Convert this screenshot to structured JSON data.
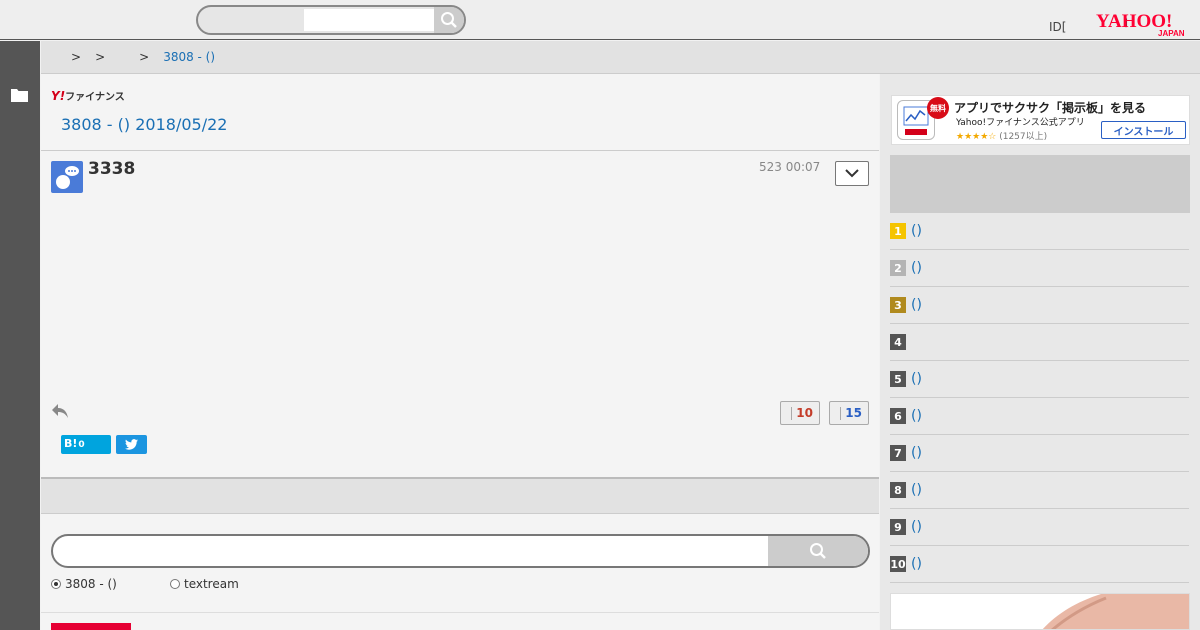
{
  "header": {
    "search_placeholder": "",
    "id_label": "ID[",
    "id_caret": "]",
    "logo_text": "YAHOO!",
    "logo_sub": "JAPAN"
  },
  "breadcrumb": {
    "sep": ">",
    "current": "3808 - ()"
  },
  "main": {
    "finance_logo_y": "Y!",
    "finance_logo_text": "ファイナンス",
    "board_title": "3808 - () 2018/05/22",
    "post": {
      "author": "3338",
      "timestamp": "523 00:07",
      "likes": "10",
      "dislikes": "15",
      "hatena_label": "B!",
      "hatena_count": "0"
    },
    "search": {
      "placeholder": "",
      "options": [
        {
          "label": "3808 - ()",
          "checked": true
        },
        {
          "label": "textream",
          "checked": false
        }
      ]
    }
  },
  "sidebar": {
    "app_ad": {
      "badge": "無料",
      "title": "アプリでサクサク「掲示板」を見る",
      "subtitle": "Yahoo!ファイナンス公式アプリ",
      "stars": "★★★★☆",
      "rating_text": "(1257以上)",
      "install_label": "インストール"
    },
    "ranking": [
      {
        "num": "1",
        "text": "()",
        "color": "#f5c400"
      },
      {
        "num": "2",
        "text": "()",
        "color": "#b4b4b4"
      },
      {
        "num": "3",
        "text": "()",
        "color": "#b08a1e"
      },
      {
        "num": "4",
        "text": "",
        "color": "#555555"
      },
      {
        "num": "5",
        "text": "()",
        "color": "#555555"
      },
      {
        "num": "6",
        "text": "()",
        "color": "#555555"
      },
      {
        "num": "7",
        "text": "()",
        "color": "#555555"
      },
      {
        "num": "8",
        "text": "()",
        "color": "#555555"
      },
      {
        "num": "9",
        "text": "()",
        "color": "#555555"
      },
      {
        "num": "10",
        "text": "()",
        "color": "#555555"
      }
    ]
  },
  "colors": {
    "link": "#1a6fb4",
    "yahoo_red": "#d4001a",
    "like_red": "#c43d2a",
    "dislike_blue": "#2a5fc4"
  }
}
